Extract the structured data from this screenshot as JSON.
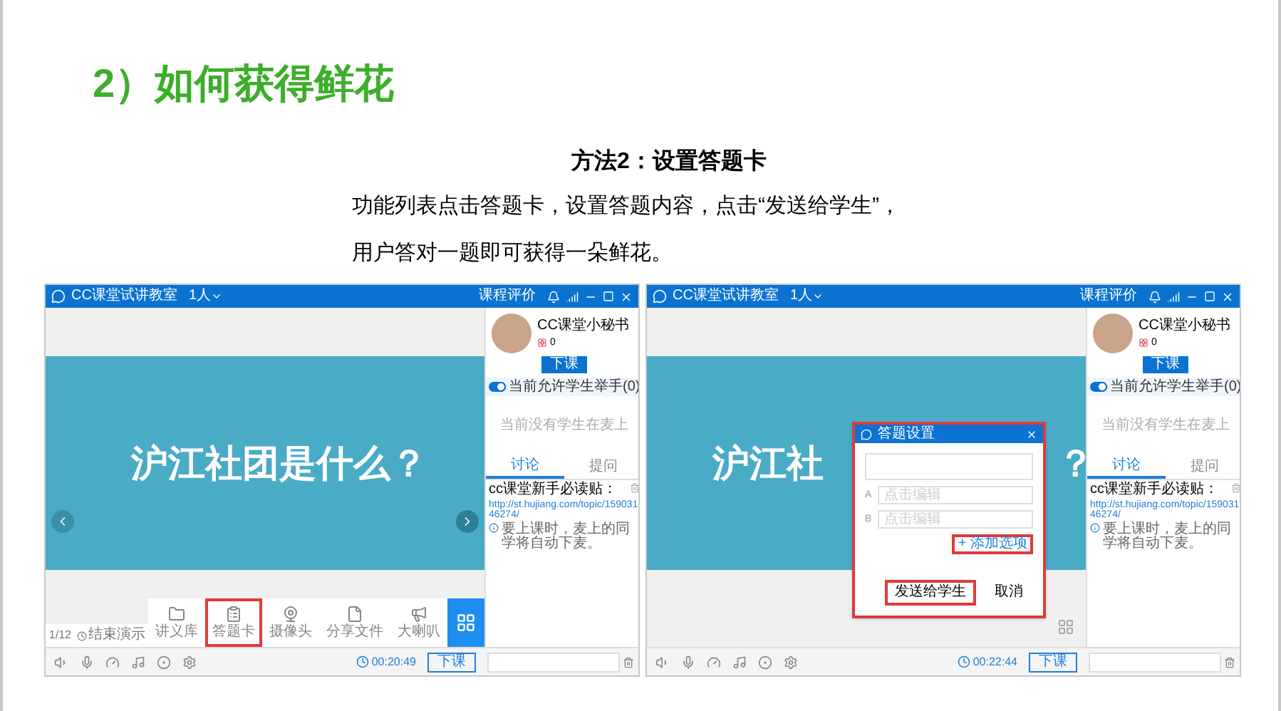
{
  "heading": "2）如何获得鲜花",
  "method_title": "方法2：设置答题卡",
  "description": [
    "功能列表点击答题卡，设置答题内容，点击“发送给学生”，",
    "用户答对一题即可获得一朵鲜花。"
  ],
  "screens": [
    {
      "title_bar": {
        "app_name": "CC课堂试讲教室",
        "people": "1人",
        "rating": "课程评价"
      },
      "profile": {
        "name": "CC课堂小秘书",
        "flowers": "0",
        "button": "下课"
      },
      "hand_toggle": {
        "label": "当前允许学生举手(0)",
        "on": true
      },
      "mic_empty": "当前没有学生在麦上",
      "tabs": [
        {
          "label": "讨论",
          "selected": true
        },
        {
          "label": "提问",
          "selected": false
        }
      ],
      "notice": {
        "title": "cc课堂新手必读贴：",
        "link": "http://st.hujiang.com/topic/15903146274/",
        "info": "要上课时，麦上的同学将自动下麦。"
      },
      "slide_text": "沪江社团是什么？",
      "page_panel": {
        "page": "1/12",
        "end_button": "结束演示"
      },
      "tools": [
        {
          "kind": "folder",
          "label": "讲义库",
          "selected": false
        },
        {
          "kind": "card",
          "label": "答题卡",
          "selected": true
        },
        {
          "kind": "camera",
          "label": "摄像头",
          "selected": false
        },
        {
          "kind": "file",
          "label": "分享文件",
          "selected": false
        },
        {
          "kind": "speaker",
          "label": "大喇叭",
          "selected": false
        }
      ],
      "status": {
        "time": "00:20:49",
        "end_button": "下课"
      }
    },
    {
      "title_bar": {
        "app_name": "CC课堂试讲教室",
        "people": "1人",
        "rating": "课程评价"
      },
      "profile": {
        "name": "CC课堂小秘书",
        "flowers": "0",
        "button": "下课"
      },
      "hand_toggle": {
        "label": "当前允许学生举手(0)",
        "on": true
      },
      "mic_empty": "当前没有学生在麦上",
      "tabs": [
        {
          "label": "讨论",
          "selected": true
        },
        {
          "label": "提问",
          "selected": false
        }
      ],
      "notice": {
        "title": "cc课堂新手必读贴：",
        "link": "http://st.hujiang.com/topic/15903146274/",
        "info": "要上课时，麦上的同学将自动下麦。"
      },
      "slide_text_parts": [
        "沪江社",
        "？"
      ],
      "dialog": {
        "title": "答题设置",
        "highlighted": true,
        "options": [
          {
            "letter": "A",
            "placeholder": "点击编辑"
          },
          {
            "letter": "B",
            "placeholder": "点击编辑"
          }
        ],
        "add_option": {
          "label": "+ 添加选项",
          "highlighted": true
        },
        "send_button": {
          "label": "发送给学生",
          "highlighted": true
        },
        "cancel_button": {
          "label": "取消",
          "highlighted": false
        }
      },
      "status": {
        "time": "00:22:44",
        "end_button": "下课"
      }
    }
  ]
}
